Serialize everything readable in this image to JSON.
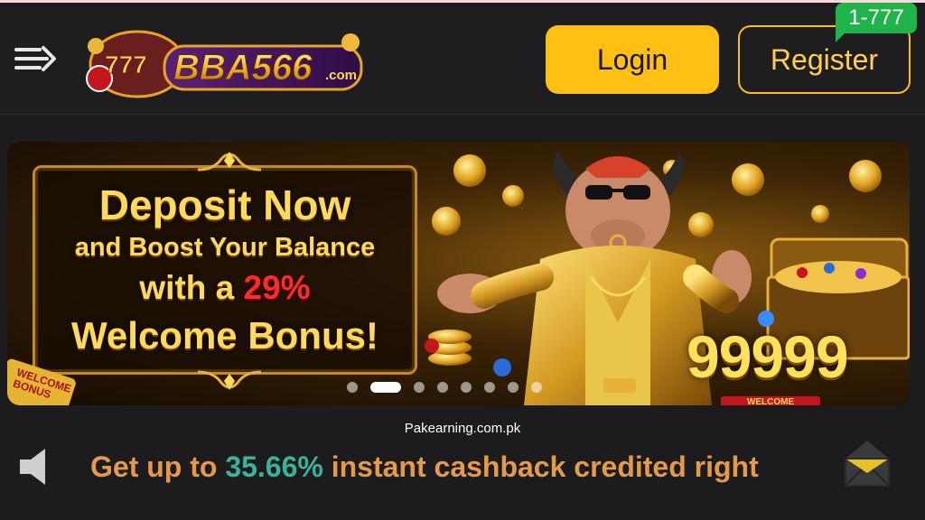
{
  "header": {
    "menu_icon": "menu-arrow-icon",
    "logo_text": "BBA566",
    "logo_suffix": ".com",
    "logo_slot": "777",
    "login_label": "Login",
    "register_label": "Register",
    "register_badge": "1-777"
  },
  "banner": {
    "line1": "Deposit Now",
    "line2": "and Boost Your Balance",
    "line3_prefix": "with a ",
    "line3_highlight": "29%",
    "line4": "Welcome Bonus!",
    "side_tag": "WELCOME BONUS",
    "big_number": "99999",
    "strip_text": "WELCOME",
    "slide_count": 8,
    "active_slide": 2
  },
  "watermark": "Pakearning.com.pk",
  "marquee": {
    "prefix": "Get up to ",
    "highlight": "35.66%",
    "suffix": " instant cashback credited right",
    "speaker_icon": "speaker-icon",
    "mail_icon": "mail-icon"
  },
  "colors": {
    "accent": "#ffbf13",
    "badge": "#1fb449",
    "background": "#1e1e20",
    "marquee_text": "#e49a4a",
    "marquee_highlight": "#3bb39a",
    "percent_red": "#ff2a2a"
  }
}
